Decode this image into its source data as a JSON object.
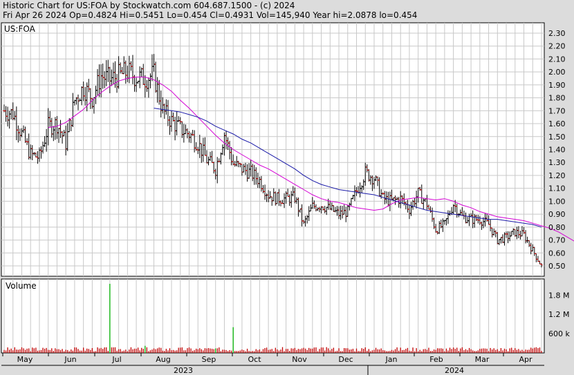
{
  "header": {
    "line1": "Historic Chart for US:FOA by Stockwatch.com 604.687.1500 - (c) 2024",
    "line2": "Fri Apr 26 2024   Op=0.4824   Hi=0.5451   Lo=0.454   Cl=0.4931   Vol=145,940   Year hi=2.0878   lo=0.454"
  },
  "colors": {
    "background": "#dcdcdc",
    "plot": "#ffffff",
    "grid": "#c8c8c8",
    "up_bar": "#000000",
    "down_bar": "#cc0000",
    "ma_short": "#d400d4",
    "ma_long": "#1a1aa8",
    "volume": "#c00000",
    "volume_spike": "#00b000"
  },
  "chart_data": [
    {
      "type": "candlestick",
      "symbol_label": "US:FOA",
      "ylim": [
        0.42,
        2.38
      ],
      "yticks": [
        "2.30",
        "2.20",
        "2.10",
        "2.00",
        "1.90",
        "1.80",
        "1.70",
        "1.60",
        "1.50",
        "1.40",
        "1.30",
        "1.20",
        "1.10",
        "1.00",
        "0.90",
        "0.80",
        "0.70",
        "0.60",
        "0.50"
      ],
      "months": [
        "May",
        "Jun",
        "Jul",
        "Aug",
        "Sep",
        "Oct",
        "Nov",
        "Dec",
        "Jan",
        "Feb",
        "Mar",
        "Apr"
      ],
      "years": [
        "2023",
        "2024"
      ],
      "weekly_close": [
        1.7,
        1.68,
        1.52,
        1.36,
        1.34,
        1.58,
        1.6,
        1.45,
        1.78,
        1.88,
        1.8,
        1.97,
        1.94,
        1.97,
        2.0,
        1.96,
        1.95,
        1.98,
        1.7,
        1.62,
        1.56,
        1.52,
        1.45,
        1.32,
        1.25,
        1.52,
        1.29,
        1.25,
        1.22,
        1.16,
        1.05,
        1.02,
        1.02,
        1.03,
        0.82,
        0.96,
        0.97,
        0.94,
        0.9,
        0.92,
        1.08,
        1.22,
        1.18,
        1.02,
        1.0,
        1.02,
        0.94,
        1.06,
        0.98,
        0.78,
        0.82,
        0.98,
        0.88,
        0.86,
        0.86,
        0.82,
        0.7,
        0.72,
        0.76,
        0.74,
        0.62,
        0.5
      ],
      "ma_short": {
        "start_index": 5,
        "values": [
          1.57,
          1.58,
          1.61,
          1.66,
          1.71,
          1.78,
          1.84,
          1.89,
          1.93,
          1.95,
          1.96,
          1.96,
          1.94,
          1.9,
          1.85,
          1.78,
          1.72,
          1.65,
          1.58,
          1.51,
          1.45,
          1.4,
          1.36,
          1.32,
          1.28,
          1.25,
          1.21,
          1.17,
          1.13,
          1.09,
          1.05,
          1.02,
          1.0,
          0.99,
          0.97,
          0.95,
          0.94,
          0.93,
          0.94,
          0.98,
          1.01,
          1.02,
          1.03,
          1.02,
          1.01,
          1.02,
          1.0,
          0.97,
          0.95,
          0.92,
          0.9,
          0.88,
          0.87,
          0.86,
          0.85,
          0.83,
          0.81,
          0.79,
          0.76,
          0.72,
          0.68
        ]
      },
      "ma_long": {
        "start_index": 17,
        "values": [
          1.72,
          1.71,
          1.7,
          1.69,
          1.67,
          1.65,
          1.62,
          1.58,
          1.55,
          1.52,
          1.48,
          1.45,
          1.41,
          1.37,
          1.33,
          1.29,
          1.25,
          1.2,
          1.16,
          1.13,
          1.11,
          1.09,
          1.08,
          1.07,
          1.06,
          1.05,
          1.03,
          1.01,
          0.99,
          0.97,
          0.95,
          0.93,
          0.92,
          0.91,
          0.9,
          0.89,
          0.88,
          0.87,
          0.86,
          0.86,
          0.85,
          0.84,
          0.83,
          0.82,
          0.8
        ]
      }
    },
    {
      "type": "bar",
      "title": "Volume",
      "yticks": [
        "1.8 M",
        "1.2 M",
        "600 k"
      ],
      "ytick_values": [
        1800000,
        1200000,
        600000
      ],
      "ylim": [
        0,
        2300000
      ],
      "spikes": [
        {
          "index": 12,
          "value": 2150000
        },
        {
          "index": 16,
          "value": 220000
        },
        {
          "index": 24,
          "value": 140000
        },
        {
          "index": 26,
          "value": 800000
        }
      ],
      "base_volume": 120000
    }
  ]
}
